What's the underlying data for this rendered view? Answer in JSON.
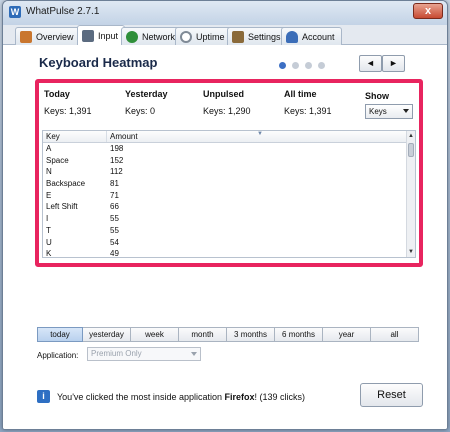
{
  "window": {
    "title": "WhatPulse 2.7.1",
    "close_label": "x"
  },
  "tabs": [
    {
      "label": "Overview",
      "icon": "home-icon",
      "color": "#c9762e"
    },
    {
      "label": "Input",
      "icon": "keyboard-icon",
      "color": "#5b6b80"
    },
    {
      "label": "Network",
      "icon": "network-icon",
      "color": "#2f8f3a"
    },
    {
      "label": "Uptime",
      "icon": "clock-icon",
      "color": "#7f8a96"
    },
    {
      "label": "Settings",
      "icon": "wrench-icon",
      "color": "#8a6a3a"
    },
    {
      "label": "Account",
      "icon": "user-icon",
      "color": "#3b6db8"
    }
  ],
  "heatmap": {
    "title": "Keyboard Heatmap",
    "page_dots": 4,
    "active_dot": 0,
    "prev_label": "◄",
    "next_label": "►"
  },
  "stats": {
    "today": {
      "label": "Today",
      "value": "Keys:  1,391"
    },
    "yesterday": {
      "label": "Yesterday",
      "value": "Keys:  0"
    },
    "unpulsed": {
      "label": "Unpulsed",
      "value": "Keys:  1,290"
    },
    "alltime": {
      "label": "All time",
      "value": "Keys:  1,391"
    },
    "show": {
      "label": "Show",
      "selected": "Keys"
    }
  },
  "table": {
    "headers": [
      "Key",
      "Amount"
    ],
    "rows": [
      {
        "key": "A",
        "amount": "198"
      },
      {
        "key": "Space",
        "amount": "152"
      },
      {
        "key": "N",
        "amount": "112"
      },
      {
        "key": "Backspace",
        "amount": "81"
      },
      {
        "key": "E",
        "amount": "71"
      },
      {
        "key": "Left Shift",
        "amount": "66"
      },
      {
        "key": "I",
        "amount": "55"
      },
      {
        "key": "T",
        "amount": "55"
      },
      {
        "key": "U",
        "amount": "54"
      },
      {
        "key": "K",
        "amount": "49"
      }
    ]
  },
  "ranges": {
    "items": [
      "today",
      "yesterday",
      "week",
      "month",
      "3 months",
      "6 months",
      "year",
      "all"
    ],
    "active": "today"
  },
  "application": {
    "label": "Application:",
    "selected": "Premium Only"
  },
  "footer": {
    "message_prefix": "You've clicked the most inside application ",
    "app_name": "Firefox",
    "message_suffix": "! (139 clicks)",
    "reset_label": "Reset"
  }
}
